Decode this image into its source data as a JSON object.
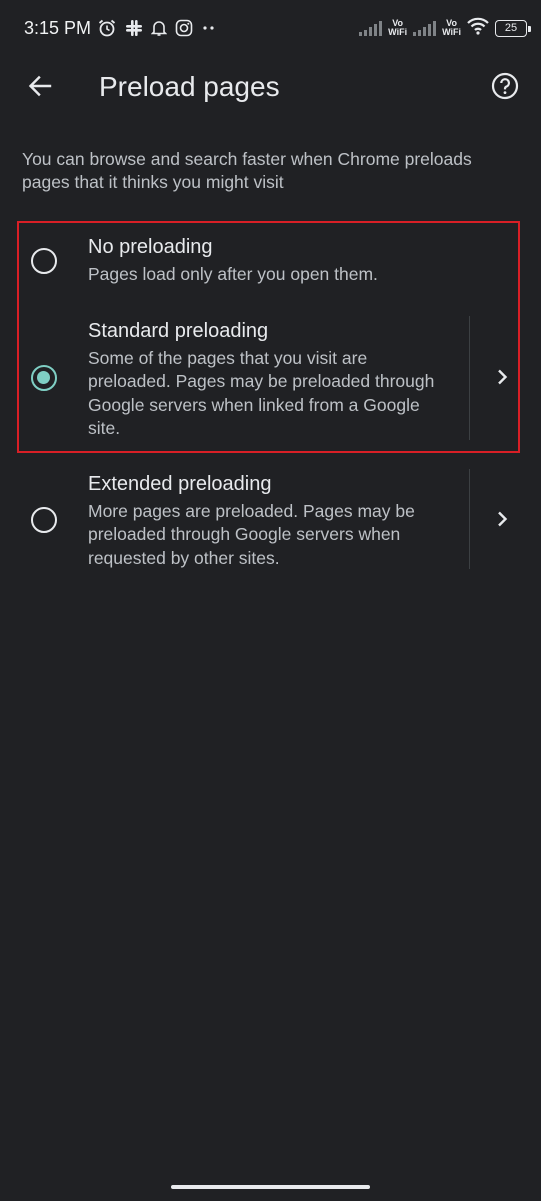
{
  "status_bar": {
    "time": "3:15 PM",
    "icons_left": [
      "alarm-icon",
      "slack-icon",
      "notification-bell-icon",
      "instagram-icon",
      "more-dots-icon"
    ],
    "network_label_1": "Vo\nWiFi",
    "network_label_2": "Vo\nWiFi",
    "battery_level": "25"
  },
  "app_bar": {
    "title": "Preload pages",
    "back_icon": "arrow-back-icon",
    "help_icon": "help-circle-icon"
  },
  "intro_text": "You can browse and search faster when Chrome preloads pages that it thinks you might visit",
  "options": [
    {
      "title": "No preloading",
      "description": "Pages load only after you open them.",
      "selected": false
    },
    {
      "title": "Standard preloading",
      "description": "Some of the pages that you visit are preloaded. Pages may be preloaded through Google servers when linked from a Google site.",
      "selected": true
    },
    {
      "title": "Extended preloading",
      "description": "More pages are preloaded. Pages may be preloaded through Google servers when requested by other sites.",
      "selected": false
    }
  ],
  "colors": {
    "background": "#202124",
    "accent": "#7fcfc4",
    "highlight_border": "#d81f26",
    "primary_text": "#e8eaed",
    "secondary_text": "#bdc1c6"
  }
}
